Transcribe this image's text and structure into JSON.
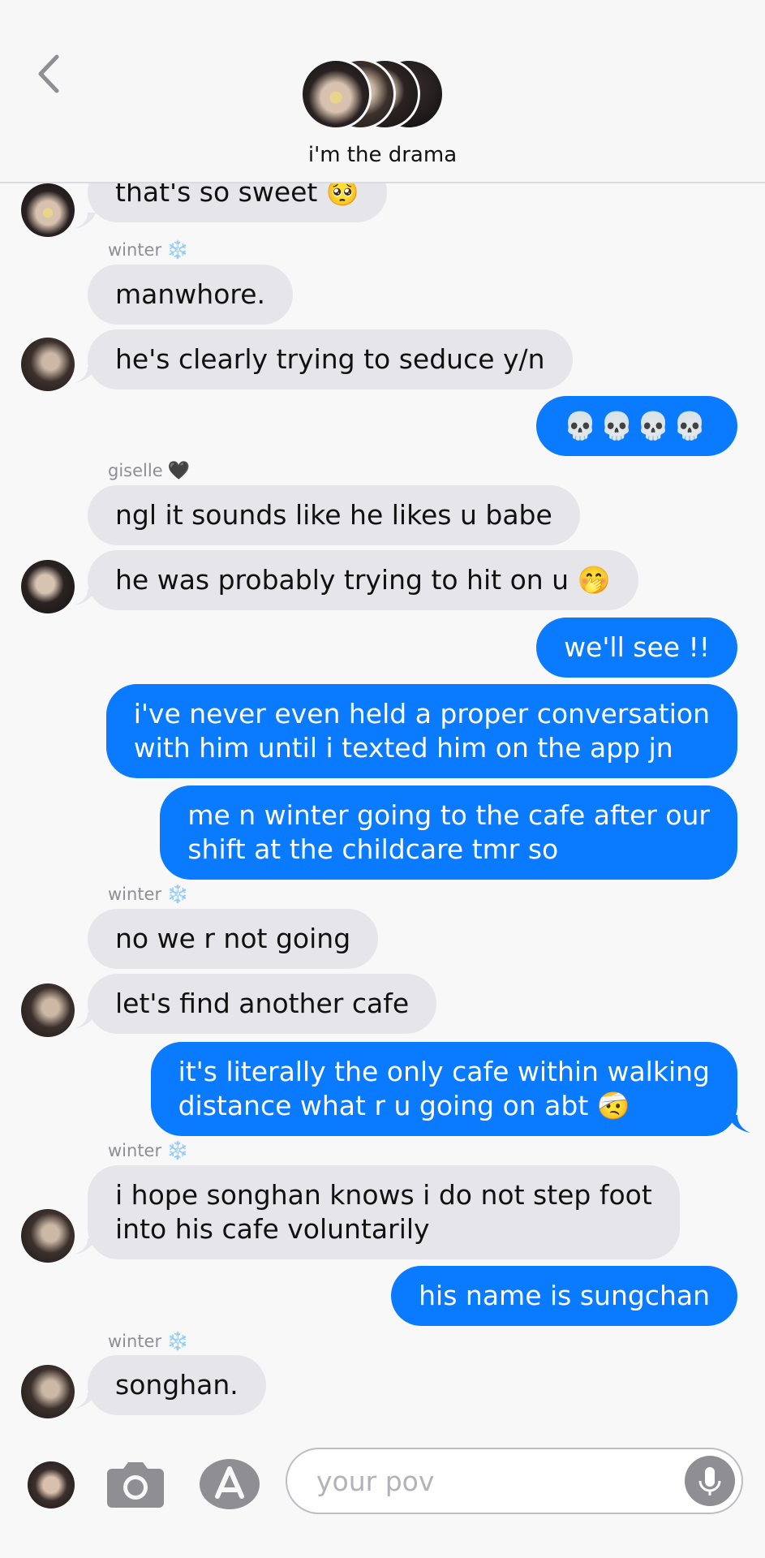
{
  "header": {
    "title": "i'm the drama"
  },
  "messages": [
    {
      "dir": "in",
      "text": "that's so sweet 🥺",
      "avatar": true
    },
    {
      "dir": "sender",
      "name": "winter",
      "emoji": "❄️"
    },
    {
      "dir": "in",
      "text": "manwhore."
    },
    {
      "dir": "in",
      "text": "he's clearly trying to seduce y/n",
      "avatar": true
    },
    {
      "dir": "out",
      "text": "💀💀💀💀"
    },
    {
      "dir": "sender",
      "name": "giselle",
      "emoji": "🖤"
    },
    {
      "dir": "in",
      "text": "ngl it sounds like he likes u babe"
    },
    {
      "dir": "in",
      "text": "he was probably trying to hit on u 🤭",
      "avatar": true
    },
    {
      "dir": "out",
      "text": "we'll see !!"
    },
    {
      "dir": "out",
      "text": "i've never even held a proper conversation\nwith him until i texted him on the app jn"
    },
    {
      "dir": "out",
      "text": "me n winter going to the cafe after our\nshift at the childcare tmr so"
    },
    {
      "dir": "sender",
      "name": "winter",
      "emoji": "❄️"
    },
    {
      "dir": "in",
      "text": "no we r not going"
    },
    {
      "dir": "in",
      "text": "let's find another cafe",
      "avatar": true
    },
    {
      "dir": "out",
      "text": "it's literally the only cafe within walking\ndistance what r u going on abt 🤕"
    },
    {
      "dir": "sender",
      "name": "winter",
      "emoji": "❄️"
    },
    {
      "dir": "in",
      "text": "i hope songhan knows i do not step foot\ninto his cafe voluntarily",
      "avatar": true
    },
    {
      "dir": "out",
      "text": "his name is sungchan"
    },
    {
      "dir": "sender",
      "name": "winter",
      "emoji": "❄️"
    },
    {
      "dir": "in",
      "text": "songhan.",
      "avatar": true
    }
  ],
  "composer": {
    "placeholder": "your pov"
  },
  "icons": {
    "back": "chevron-left-icon",
    "camera": "camera-icon",
    "apps": "app-store-icon",
    "mic": "microphone-icon"
  },
  "colors": {
    "outgoing": "#0a7aff",
    "incoming": "#e5e5ea"
  }
}
